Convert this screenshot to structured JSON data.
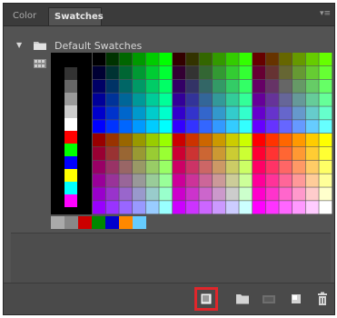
{
  "tabs": [
    {
      "label": "Color",
      "active": false
    },
    {
      "label": "Swatches",
      "active": true
    }
  ],
  "panel_menu_icon": "panel-menu-icon",
  "group": {
    "label": "Default Swatches",
    "expanded": true,
    "icon": "folder-icon"
  },
  "view_icon": "grid-view-icon",
  "gray_column": [
    "#333333",
    "#666666",
    "#999999",
    "#cccccc",
    "#ffffff",
    "#ff0000",
    "#00ff00",
    "#0000ff",
    "#ffff00",
    "#00ffff",
    "#ff00ff"
  ],
  "extra_row": [
    "#aaaaaa",
    "#888888",
    "#cc0000",
    "#008800",
    "#0000cc",
    "#ff8800",
    "#66ccff"
  ],
  "toolbar": {
    "buttons": [
      {
        "name": "new-swatch-button",
        "icon": "new-swatch-icon",
        "highlighted": true
      },
      {
        "name": "new-group-button",
        "icon": "folder-icon",
        "highlighted": false
      },
      {
        "name": "load-swatches-button",
        "icon": "library-icon",
        "highlighted": false
      },
      {
        "name": "create-new-button",
        "icon": "new-page-icon",
        "highlighted": false
      },
      {
        "name": "delete-button",
        "icon": "trash-icon",
        "highlighted": false
      }
    ]
  },
  "colors": {
    "panel_bg": "#535353",
    "tab_bg": "#3b3b3b",
    "highlight": "#e0262b"
  }
}
